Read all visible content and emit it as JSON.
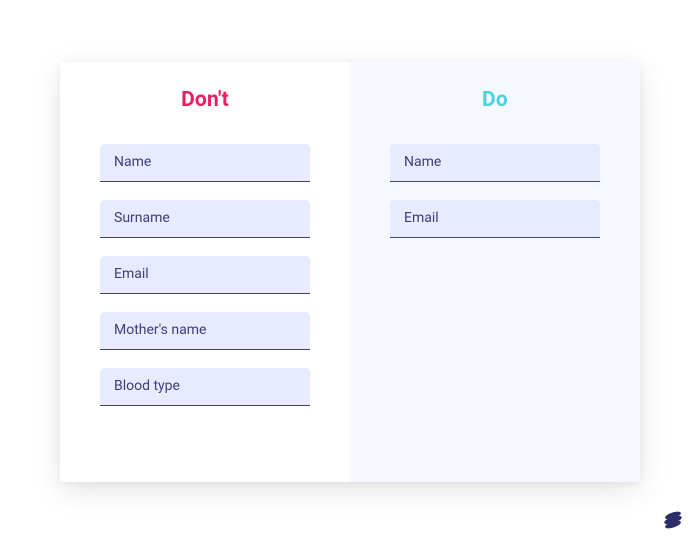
{
  "dont": {
    "title": "Don't",
    "color": "#e91e63",
    "fields": [
      {
        "label": "Name"
      },
      {
        "label": "Surname"
      },
      {
        "label": "Email"
      },
      {
        "label": "Mother's name"
      },
      {
        "label": "Blood type"
      }
    ]
  },
  "do": {
    "title": "Do",
    "color": "#4dd0e1",
    "fields": [
      {
        "label": "Name"
      },
      {
        "label": "Email"
      }
    ]
  }
}
